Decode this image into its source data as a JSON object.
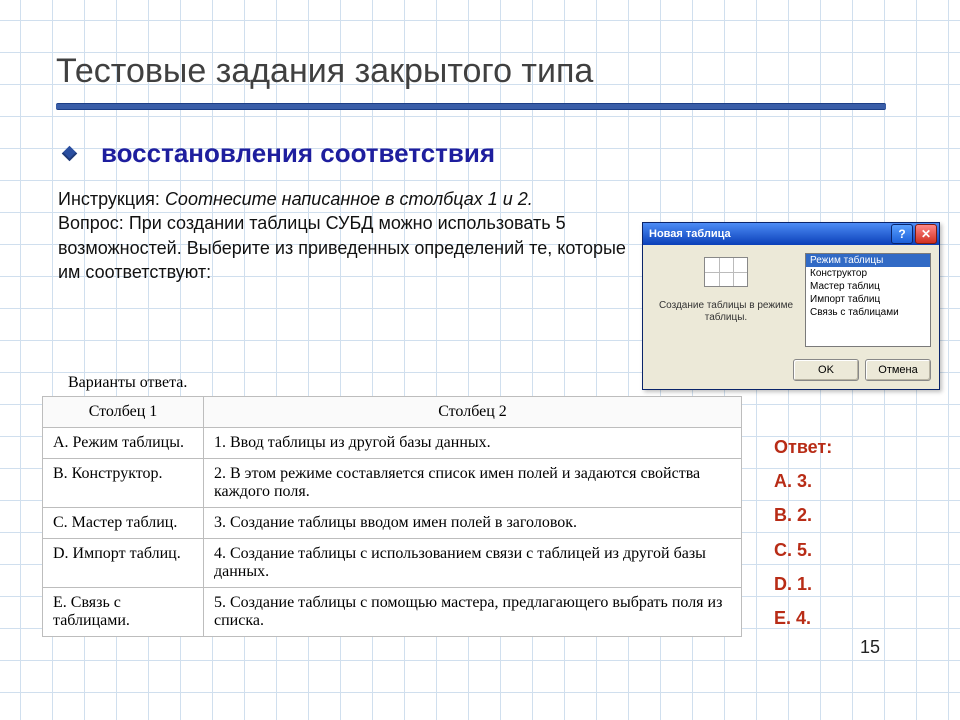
{
  "title": "Тестовые задания закрытого типа",
  "subtitle": "восстановления соответствия",
  "instruction_label": "Инструкция:",
  "instruction_text": "Соотнесите написанное в столбцах 1 и 2.",
  "question_label": "Вопрос:",
  "question_text": "При создании таблицы СУБД можно использовать 5 возможностей. Выберите из приведенных определений те, которые им соответствуют:",
  "table_caption": "Варианты ответа.",
  "columns": {
    "c1": "Столбец 1",
    "c2": "Столбец 2"
  },
  "rows": [
    {
      "c1": "A. Режим таблицы.",
      "c2": "1. Ввод таблицы из другой базы данных."
    },
    {
      "c1": "B. Конструктор.",
      "c2": "2. В этом режиме составляется список имен полей и задаются свойства каждого поля."
    },
    {
      "c1": "C. Мастер таблиц.",
      "c2": "3. Создание таблицы вводом имен полей в заголовок."
    },
    {
      "c1": "D. Импорт таблиц.",
      "c2": "4. Создание таблицы с использованием связи с таблицей из другой базы данных."
    },
    {
      "c1": "E. Связь с таблицами.",
      "c2": "5. Создание таблицы с помощью мастера, предлагающего выбрать поля из списка."
    }
  ],
  "answers": {
    "label": "Ответ:",
    "items": [
      "A. 3.",
      "B. 2.",
      "C. 5.",
      "D. 1.",
      "E. 4."
    ]
  },
  "page_number": "15",
  "dialog": {
    "title": "Новая таблица",
    "left_caption": "Создание таблицы в режиме таблицы.",
    "list": [
      "Режим таблицы",
      "Конструктор",
      "Мастер таблиц",
      "Импорт таблиц",
      "Связь с таблицами"
    ],
    "ok": "OK",
    "cancel": "Отмена",
    "help_glyph": "?",
    "close_glyph": "✕"
  }
}
